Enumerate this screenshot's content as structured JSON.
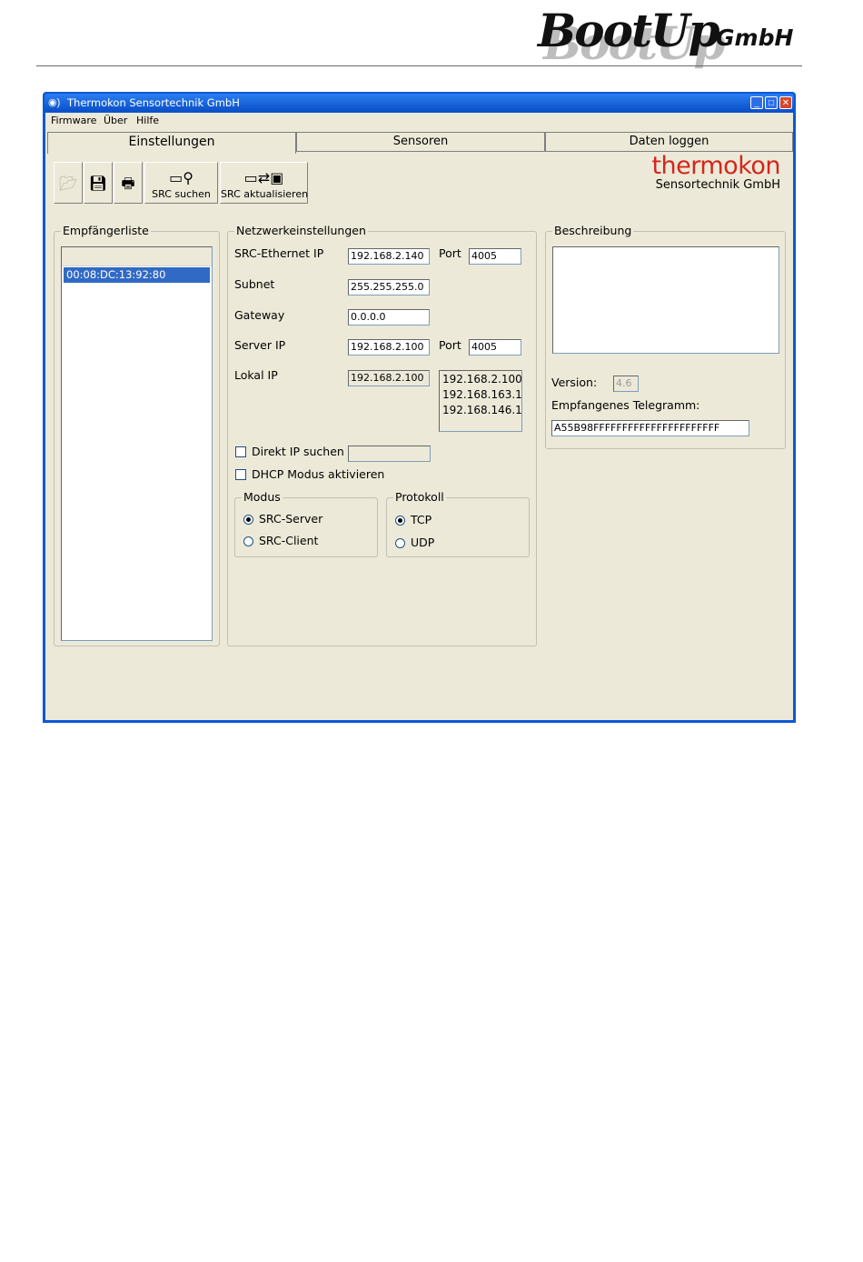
{
  "header": {
    "brand_main": "BootUp",
    "brand_suffix": "GmbH"
  },
  "window": {
    "title": "Thermokon Sensortechnik GmbH"
  },
  "menu": [
    {
      "label": "Firmware"
    },
    {
      "label": "Über"
    },
    {
      "label": "Hilfe"
    }
  ],
  "tabs": [
    {
      "label": "Einstellungen",
      "active": true
    },
    {
      "label": "Sensoren",
      "active": false
    },
    {
      "label": "Daten loggen",
      "active": false
    }
  ],
  "toolbar": {
    "open_icon": "folder-open-icon",
    "save_icon": "floppy-disk-icon",
    "print_icon": "printer-icon",
    "search_label": "SRC suchen",
    "update_label": "SRC aktualisieren"
  },
  "vendor_logo": {
    "line1": "thermokon",
    "line2": "Sensortechnik GmbH",
    "color": "#d4261c"
  },
  "receiver_list": {
    "title": "Empfängerliste",
    "items": [
      "00:08:DC:13:92:80"
    ]
  },
  "network": {
    "title": "Netzwerkeinstellungen",
    "src_ip_label": "SRC-Ethernet IP",
    "src_ip": "192.168.2.140",
    "port_label": "Port",
    "src_port": "4005",
    "subnet_label": "Subnet",
    "subnet": "255.255.255.0",
    "gateway_label": "Gateway",
    "gateway": "0.0.0.0",
    "server_ip_label": "Server IP",
    "server_ip": "192.168.2.100",
    "server_port": "4005",
    "local_ip_label": "Lokal IP",
    "local_ip": "192.168.2.100",
    "local_ip_list": [
      "192.168.2.100",
      "192.168.163.1",
      "192.168.146.1"
    ],
    "direct_ip_label": "Direkt IP suchen",
    "direct_ip_checked": false,
    "direct_ip_value": "",
    "dhcp_label": "DHCP Modus aktivieren",
    "dhcp_checked": false
  },
  "mode": {
    "title": "Modus",
    "options": [
      {
        "label": "SRC-Server",
        "selected": true
      },
      {
        "label": "SRC-Client",
        "selected": false
      }
    ]
  },
  "protocol": {
    "title": "Protokoll",
    "options": [
      {
        "label": "TCP",
        "selected": true
      },
      {
        "label": "UDP",
        "selected": false
      }
    ]
  },
  "description": {
    "title": "Beschreibung",
    "text": "",
    "version_label": "Version:",
    "version": "4.6",
    "telegram_label": "Empfangenes Telegramm:",
    "telegram": "A55B98FFFFFFFFFFFFFFFFFFFFFF"
  }
}
